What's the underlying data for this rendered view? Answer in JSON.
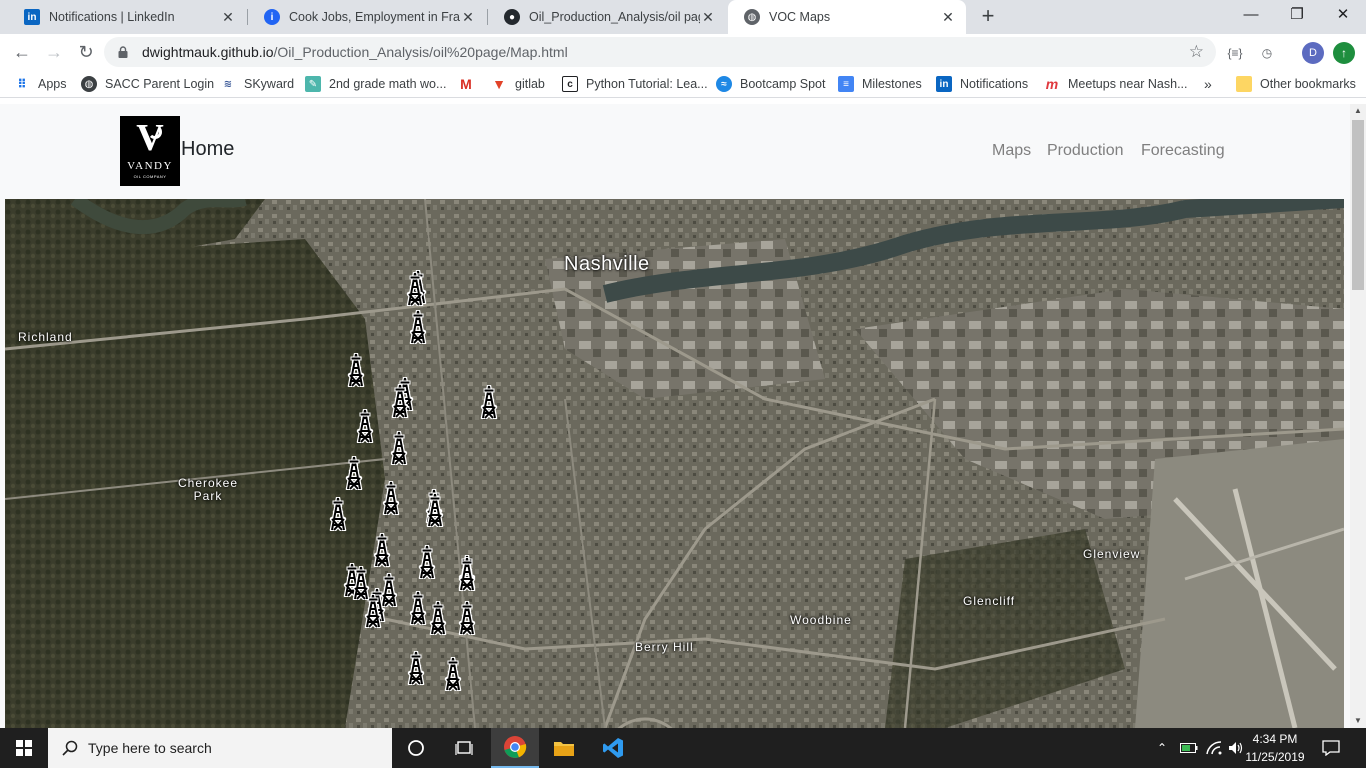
{
  "browser": {
    "tabs": [
      {
        "title": "Notifications | LinkedIn",
        "icon": "linkedin-icon",
        "color": "#0a66c2"
      },
      {
        "title": "Cook Jobs, Employment in Frankl",
        "icon": "indeed-icon",
        "color": "#2164f3"
      },
      {
        "title": "Oil_Production_Analysis/oil page",
        "icon": "github-icon",
        "color": "#24292e"
      },
      {
        "title": "VOC Maps",
        "icon": "globe-icon",
        "color": "#5f6368"
      }
    ],
    "url_host": "dwightmauk.github.io",
    "url_path": "/Oil_Production_Analysis/oil%20page/Map.html",
    "bookmarks": [
      {
        "label": "Apps",
        "icon": "apps-grid-icon"
      },
      {
        "label": "SACC Parent Login",
        "icon": "globe-icon"
      },
      {
        "label": "SKyward",
        "icon": "skyward-icon"
      },
      {
        "label": "2nd grade math wo...",
        "icon": "math-icon"
      },
      {
        "label": "",
        "icon": "gmail-icon"
      },
      {
        "label": "gitlab",
        "icon": "gitlab-icon"
      },
      {
        "label": "Python Tutorial: Lea...",
        "icon": "python-tutorial-icon"
      },
      {
        "label": "Bootcamp Spot",
        "icon": "bootcamp-icon"
      },
      {
        "label": "Milestones",
        "icon": "docs-icon"
      },
      {
        "label": "Notifications",
        "icon": "linkedin-icon"
      },
      {
        "label": "Meetups near Nash...",
        "icon": "meetup-icon"
      }
    ],
    "more_bookmarks": "»",
    "other_bookmarks": "Other bookmarks",
    "avatar_letter": "D"
  },
  "site": {
    "logo_brand": "VANDY",
    "logo_sub": "OIL COMPANY",
    "home_label": "Home",
    "nav": [
      "Maps",
      "Production",
      "Forecasting"
    ]
  },
  "map": {
    "labels": [
      {
        "text": "Nashville",
        "size": "big"
      },
      {
        "text": "Richland",
        "size": "small"
      },
      {
        "text": "Cherokee\nPark",
        "size": "small"
      },
      {
        "text": "Berry Hill",
        "size": "small"
      },
      {
        "text": "Woodbine",
        "size": "small"
      },
      {
        "text": "Glencliff",
        "size": "small"
      },
      {
        "text": "Glenview",
        "size": "small"
      }
    ],
    "well_count": 28,
    "marker_icon": "oil-derrick-icon"
  },
  "taskbar": {
    "search_placeholder": "Type here to search",
    "time": "4:34 PM",
    "date": "11/25/2019"
  },
  "colors": {
    "tabbar": "#dee1e6",
    "taskbar": "#1f1f1f",
    "nav_link": "#7f7f7f"
  }
}
